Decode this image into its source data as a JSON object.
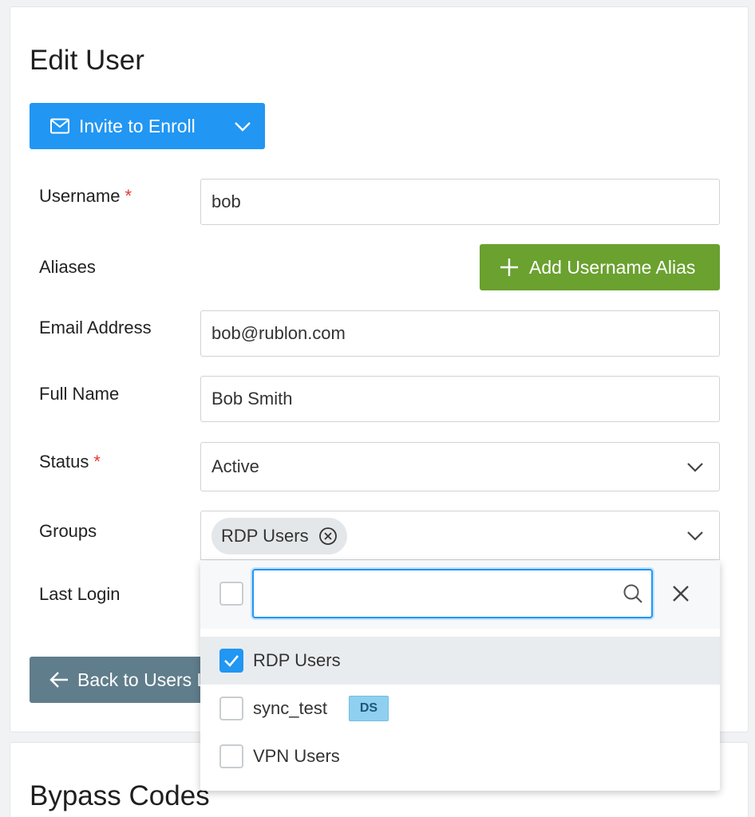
{
  "edit_user": {
    "title": "Edit User",
    "invite_button_label": "Invite to Enroll",
    "fields": {
      "username": {
        "label": "Username",
        "required_mark": "*",
        "value": "bob"
      },
      "aliases": {
        "label": "Aliases",
        "add_button_label": "Add Username Alias"
      },
      "email": {
        "label": "Email Address",
        "value": "bob@rublon.com"
      },
      "full_name": {
        "label": "Full Name",
        "value": "Bob Smith"
      },
      "status": {
        "label": "Status",
        "required_mark": "*",
        "value": "Active"
      },
      "groups": {
        "label": "Groups",
        "selected": [
          "RDP Users"
        ]
      },
      "last_login": {
        "label": "Last Login"
      }
    },
    "back_button_label": "Back to Users List"
  },
  "groups_dropdown": {
    "search_value": "",
    "options": [
      {
        "name": "RDP Users",
        "checked": true,
        "badge": ""
      },
      {
        "name": "sync_test",
        "checked": false,
        "badge": "DS"
      },
      {
        "name": "VPN Users",
        "checked": false,
        "badge": ""
      }
    ]
  },
  "bypass_codes": {
    "title": "Bypass Codes"
  },
  "colors": {
    "primary": "#2196f3",
    "success": "#6aa12f",
    "secondary": "#607d8b",
    "required": "#e53935",
    "badge_ds": "#8fd0f0"
  },
  "icons": {
    "invite": "envelope-icon",
    "invite_toggle": "chevron-down-icon",
    "add_alias": "plus-icon",
    "back": "arrow-left-icon",
    "search": "magnifier-icon",
    "clear": "close-icon",
    "chip_remove": "circle-x-icon",
    "checkbox_checked": "checkmark-icon"
  }
}
